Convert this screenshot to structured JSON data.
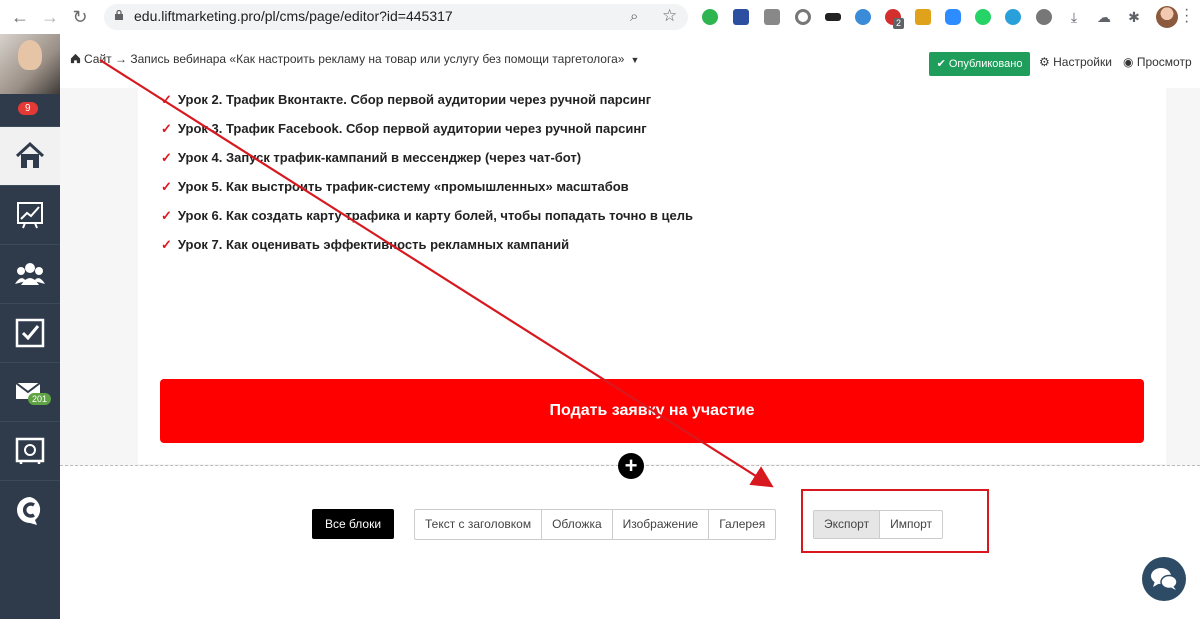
{
  "browser": {
    "url": "edu.liftmarketing.pro/pl/cms/page/editor?id=445317",
    "ext_badge": "2"
  },
  "sidebar": {
    "notif_count": "9",
    "mail_count": "201"
  },
  "topbar": {
    "crumb_site": "Сайт",
    "crumb_sep": "→",
    "crumb_page": "Запись вебинара «Как настроить рекламу на товар или услугу без помощи таргетолога»",
    "published_label": "Опубликовано",
    "settings_label": "Настройки",
    "preview_label": "Просмотр"
  },
  "content": {
    "lessons": [
      "Урок 2. Трафик Вконтакте. Сбор первой аудитории через ручной парсинг",
      "Урок 3. Трафик Facebook. Сбор первой аудитории через ручной парсинг",
      "Урок 4. Запуск трафик-кампаний в мессенджер (через чат-бот)",
      "Урок 5. Как выстроить трафик-систему «промышленных» масштабов",
      "Урок 6. Как создать карту трафика и карту болей, чтобы попадать точно в цель",
      "Урок 7. Как оценивать эффективность рекламных кампаний"
    ],
    "cta_label": "Подать заявку на участие",
    "add_symbol": "+"
  },
  "blocks": {
    "all_label": "Все блоки",
    "types": [
      "Текст с заголовком",
      "Обложка",
      "Изображение",
      "Галерея"
    ],
    "export_label": "Экспорт",
    "import_label": "Импорт"
  },
  "colors": {
    "cta": "#ff0000",
    "published": "#1e9e5a",
    "annotation": "#d7191f",
    "sidebar": "#2f3b4a"
  }
}
